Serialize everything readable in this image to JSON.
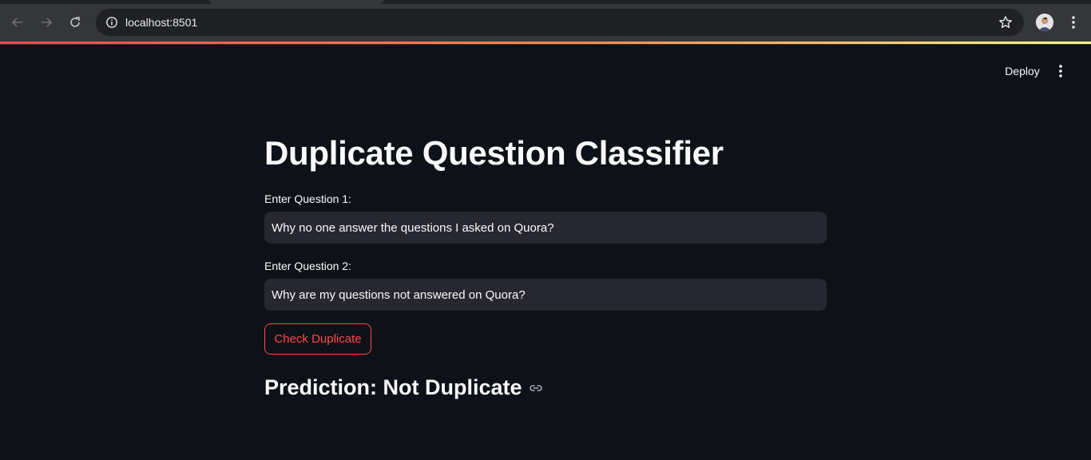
{
  "browser": {
    "url": "localhost:8501",
    "icons": {
      "back": "arrow-left-icon",
      "forward": "arrow-right-icon",
      "reload": "reload-icon",
      "site_info": "info-icon",
      "bookmark": "star-icon",
      "profile": "avatar",
      "menu": "kebab-menu-icon"
    }
  },
  "app": {
    "header": {
      "deploy_label": "Deploy",
      "menu_icon": "kebab-menu-icon"
    },
    "title": "Duplicate Question Classifier",
    "question1": {
      "label": "Enter Question 1:",
      "value": "Why no one answer the questions I asked on Quora?"
    },
    "question2": {
      "label": "Enter Question 2:",
      "value": "Why are my questions not answered on Quora?"
    },
    "button_label": "Check Duplicate",
    "prediction": "Prediction: Not Duplicate",
    "colors": {
      "background": "#0e1117",
      "input_bg": "#262730",
      "accent": "#ff4b4b",
      "text": "#fafafa"
    }
  }
}
